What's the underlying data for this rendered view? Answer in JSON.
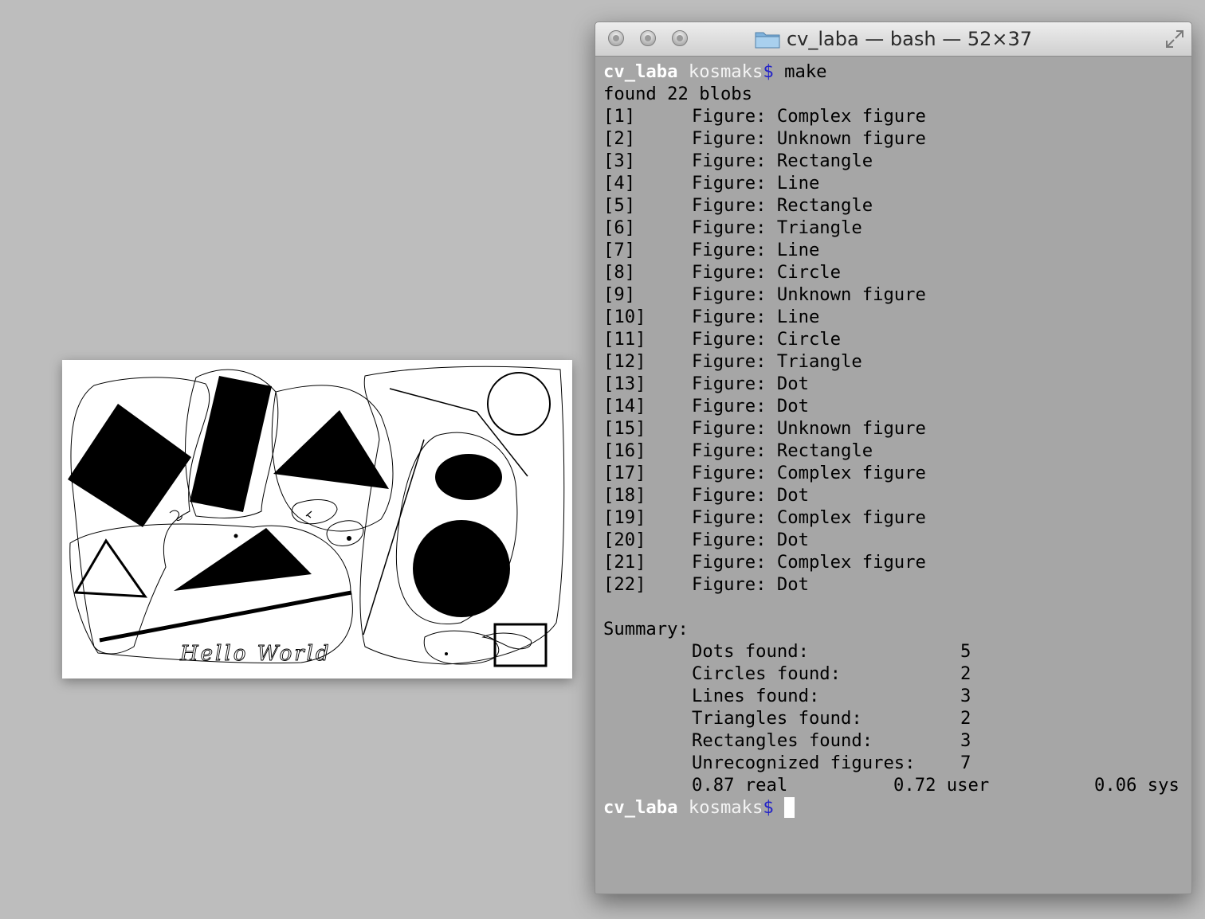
{
  "image_viewer": {
    "handwritten_text": "Hello World"
  },
  "terminal": {
    "title": "cv_laba — bash — 52×37",
    "prompt": {
      "host": "cv_laba",
      "user": "kosmaks",
      "symbol": "$"
    },
    "command": "make",
    "found_line": "found 22 blobs",
    "figures": [
      {
        "index": "[1]",
        "label": "Figure: Complex figure"
      },
      {
        "index": "[2]",
        "label": "Figure: Unknown figure"
      },
      {
        "index": "[3]",
        "label": "Figure: Rectangle"
      },
      {
        "index": "[4]",
        "label": "Figure: Line"
      },
      {
        "index": "[5]",
        "label": "Figure: Rectangle"
      },
      {
        "index": "[6]",
        "label": "Figure: Triangle"
      },
      {
        "index": "[7]",
        "label": "Figure: Line"
      },
      {
        "index": "[8]",
        "label": "Figure: Circle"
      },
      {
        "index": "[9]",
        "label": "Figure: Unknown figure"
      },
      {
        "index": "[10]",
        "label": "Figure: Line"
      },
      {
        "index": "[11]",
        "label": "Figure: Circle"
      },
      {
        "index": "[12]",
        "label": "Figure: Triangle"
      },
      {
        "index": "[13]",
        "label": "Figure: Dot"
      },
      {
        "index": "[14]",
        "label": "Figure: Dot"
      },
      {
        "index": "[15]",
        "label": "Figure: Unknown figure"
      },
      {
        "index": "[16]",
        "label": "Figure: Rectangle"
      },
      {
        "index": "[17]",
        "label": "Figure: Complex figure"
      },
      {
        "index": "[18]",
        "label": "Figure: Dot"
      },
      {
        "index": "[19]",
        "label": "Figure: Complex figure"
      },
      {
        "index": "[20]",
        "label": "Figure: Dot"
      },
      {
        "index": "[21]",
        "label": "Figure: Complex figure"
      },
      {
        "index": "[22]",
        "label": "Figure: Dot"
      }
    ],
    "summary_header": "Summary:",
    "summary": [
      {
        "label": "Dots found:",
        "value": "5"
      },
      {
        "label": "Circles found:",
        "value": "2"
      },
      {
        "label": "Lines found:",
        "value": "3"
      },
      {
        "label": "Triangles found:",
        "value": "2"
      },
      {
        "label": "Rectangles found:",
        "value": "3"
      },
      {
        "label": "Unrecognized figures:",
        "value": "7"
      }
    ],
    "timing": {
      "real": "0.87 real",
      "user": "0.72 user",
      "sys": "0.06 sys"
    }
  },
  "colors": {
    "desktop": "#bdbdbd",
    "terminal_bg": "#a6a6a6",
    "prompt_symbol": "#2323c8"
  }
}
